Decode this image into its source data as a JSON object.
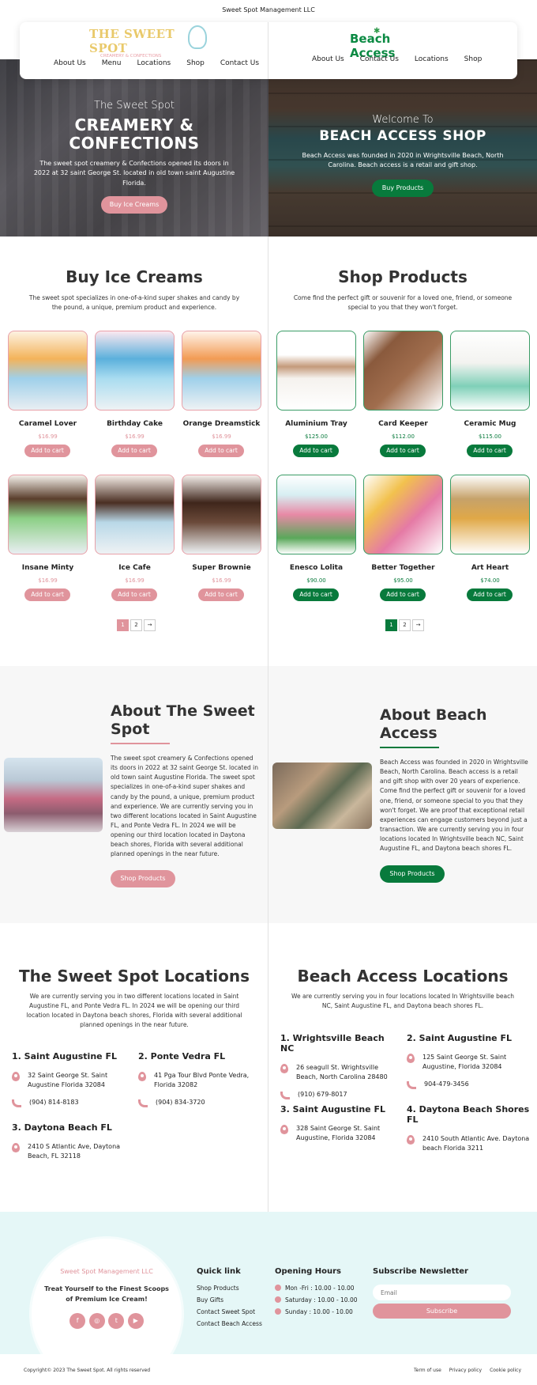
{
  "topbar": {
    "company": "Sweet Spot Management LLC"
  },
  "nav": {
    "left": {
      "logo_title": "THE SWEET SPOT",
      "logo_sub": "CREAMERY & CONFECTIONS",
      "links": [
        "About Us",
        "Menu",
        "Locations",
        "Shop",
        "Contact Us"
      ]
    },
    "right": {
      "logo_text": "Beach Access",
      "links": [
        "About Us",
        "Contact Us",
        "Locations",
        "Shop"
      ]
    }
  },
  "hero": {
    "left": {
      "sub": "The Sweet Spot",
      "title1": "CREAMERY &",
      "title2": "CONFECTIONS",
      "desc": "The sweet spot creamery & Confections opened its doors in 2022 at 32 saint George St. located in old town saint Augustine Florida.",
      "button": "Buy Ice Creams"
    },
    "right": {
      "sub": "Welcome To",
      "title": "BEACH ACCESS SHOP",
      "desc": "Beach Access was founded in 2020 in Wrightsville Beach, North Carolina. Beach access is a retail and gift shop.",
      "button": "Buy Products"
    }
  },
  "ice": {
    "title": "Buy Ice Creams",
    "desc": "The sweet spot specializes in one-of-a-kind super shakes and candy by the pound, a unique, premium product and experience.",
    "products": [
      {
        "name": "Caramel Lover",
        "price": "$16.99",
        "cart": "Add to cart"
      },
      {
        "name": "Birthday Cake",
        "price": "$16.99",
        "cart": "Add to cart"
      },
      {
        "name": "Orange Dreamstick",
        "price": "$16.99",
        "cart": "Add to cart"
      },
      {
        "name": "Insane Minty",
        "price": "$16.99",
        "cart": "Add to cart"
      },
      {
        "name": "Ice Cafe",
        "price": "$16.99",
        "cart": "Add to cart"
      },
      {
        "name": "Super Brownie",
        "price": "$16.99",
        "cart": "Add to cart"
      }
    ],
    "pager": [
      "1",
      "2",
      "→"
    ]
  },
  "shop": {
    "title": "Shop Products",
    "desc": "Come find the perfect gift or souvenir for a loved one, friend, or someone special to you that they won't forget.",
    "products": [
      {
        "name": "Aluminium Tray",
        "price": "$125.00",
        "cart": "Add to cart"
      },
      {
        "name": "Card Keeper",
        "price": "$112.00",
        "cart": "Add to cart"
      },
      {
        "name": "Ceramic Mug",
        "price": "$115.00",
        "cart": "Add to cart"
      },
      {
        "name": "Enesco Lolita",
        "price": "$90.00",
        "cart": "Add to cart"
      },
      {
        "name": "Better Together",
        "price": "$95.00",
        "cart": "Add to cart"
      },
      {
        "name": "Art Heart",
        "price": "$74.00",
        "cart": "Add to cart"
      }
    ],
    "pager": [
      "1",
      "2",
      "→"
    ]
  },
  "about": {
    "left": {
      "title": "About The Sweet Spot",
      "body": "The sweet spot creamery & Confections opened its doors in 2022 at 32 saint George St. located in old town saint Augustine Florida. The sweet spot specializes in one-of-a-kind super shakes and candy by the pound, a unique, premium product and experience. We are currently serving you in two different locations located in Saint Augustine FL, and Ponte Vedra FL. In 2024 we will be opening our third location located in Daytona beach shores, Florida with several additional planned openings in the near future.",
      "button": "Shop Products"
    },
    "right": {
      "title": "About Beach Access",
      "body": "Beach Access was founded in 2020 in Wrightsville Beach, North Carolina. Beach access is a retail and gift shop with over 20 years of experience. Come find the perfect gift or souvenir for a loved one, friend, or someone special to you that they won't forget. We are proof that exceptional retail experiences can engage customers beyond just a transaction. We are currently serving you in four locations located In Wrightsville beach NC, Saint Augustine FL, and Daytona beach shores FL.",
      "button": "Shop Products"
    }
  },
  "locations": {
    "left": {
      "title": "The Sweet Spot Locations",
      "desc": "We are currently serving you in two different locations located in Saint Augustine FL, and Ponte Vedra FL. In 2024 we will be opening our third location located in Daytona beach shores, Florida with several additional planned openings in the near future.",
      "items": [
        {
          "name": "1. Saint Augustine FL",
          "address": "32 Saint George St. Saint Augustine Florida 32084",
          "phone": "(904) 814-8183"
        },
        {
          "name": "2. Ponte Vedra FL",
          "address": "41 Pga Tour Blvd Ponte Vedra, Florida 32082",
          "phone": "(904) 834-3720"
        },
        {
          "name": "3. Daytona Beach FL",
          "address": "2410 S Atlantic Ave, Daytona Beach, FL 32118"
        }
      ]
    },
    "right": {
      "title": "Beach Access Locations",
      "desc": "We are currently serving you in four locations located In Wrightsville beach NC, Saint Augustine FL, and Daytona beach shores FL.",
      "items": [
        {
          "name": "1. Wrightsville Beach NC",
          "address": "26 seagull St. Wrightsville Beach, North Carolina 28480",
          "phone": "(910) 679-8017"
        },
        {
          "name": "2. Saint Augustine FL",
          "address": "125 Saint George St. Saint Augustine, Florida 32084",
          "phone": "904-479-3456"
        },
        {
          "name": "3. Saint Augustine FL",
          "address": "328 Saint George St. Saint Augustine, Florida 32084"
        },
        {
          "name": "4. Daytona Beach Shores FL",
          "address": "2410 South Atlantic Ave. Daytona beach Florida 3211"
        }
      ]
    }
  },
  "footer": {
    "company": "Sweet Spot Management LLC",
    "tagline": "Treat Yourself to the Finest Scoops of Premium Ice Cream!",
    "social": [
      "f",
      "◎",
      "t",
      "▶"
    ],
    "quick": {
      "title": "Quick link",
      "links": [
        "Shop Products",
        "Buy Gifts",
        "Contact Sweet Spot",
        "Contact Beach Access"
      ]
    },
    "hours": {
      "title": "Opening Hours",
      "items": [
        "Mon -Fri : 10.00 - 10.00",
        "Saturday : 10.00 - 10.00",
        "Sunday : 10.00 - 10.00"
      ]
    },
    "newsletter": {
      "title": "Subscribe Newsletter",
      "placeholder": "Email",
      "button": "Subscribe"
    },
    "copyright": "Copyright© 2023 The Sweet Spot. All rights reserved",
    "legal": [
      "Term of use",
      "Privacy policy",
      "Cookie policy"
    ]
  },
  "colors": {
    "pink": "#e0949c",
    "green": "#087a3c",
    "mint": "#e5f7f7"
  }
}
